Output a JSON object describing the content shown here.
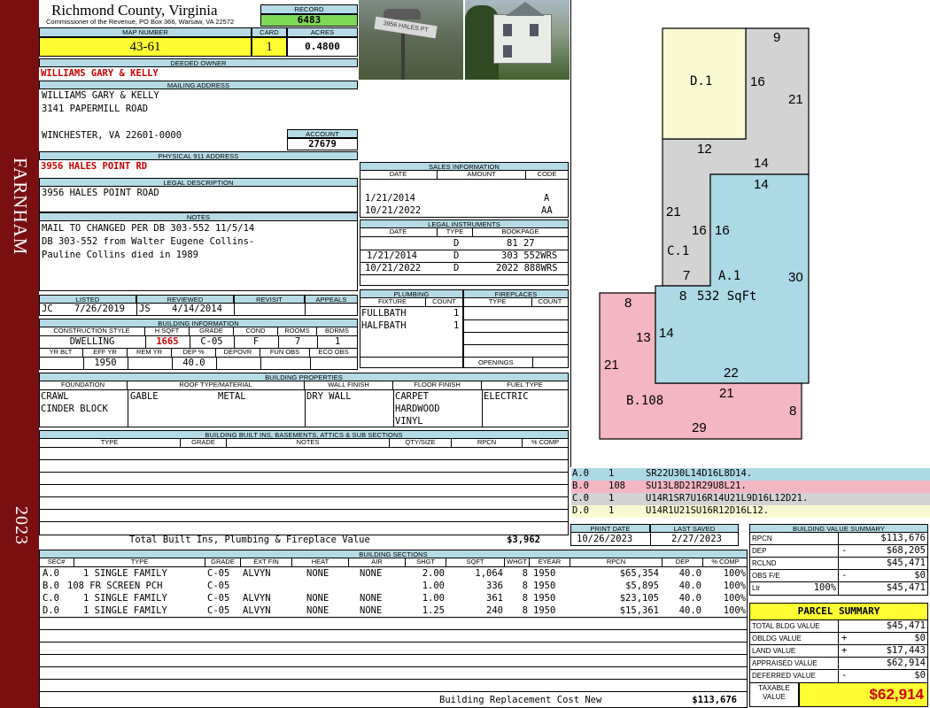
{
  "sidebar": {
    "district": "FARNHAM",
    "year": "2023"
  },
  "header": {
    "county": "Richmond County, Virginia",
    "commissioner": "Commissioner of the Revenue, PO Box 366, Warsaw, VA 22572",
    "record_label": "RECORD",
    "record": "6483",
    "map_label": "MAP NUMBER",
    "map": "43-61",
    "card_label": "CARD",
    "card": "1",
    "acres_label": "ACRES",
    "acres": "0.4800"
  },
  "owner": {
    "deeded_label": "DEEDED OWNER",
    "deeded": "WILLIAMS GARY & KELLY",
    "mailing_label": "MAILING ADDRESS",
    "mail1": "WILLIAMS GARY & KELLY",
    "mail2": "3141 PAPERMILL ROAD",
    "mail3": "WINCHESTER, VA 22601-0000",
    "account_label": "ACCOUNT",
    "account": "27679",
    "physical_label": "PHYSICAL 911 ADDRESS",
    "physical": "3956 HALES POINT RD",
    "legal_label": "LEGAL DESCRIPTION",
    "legal": "3956 HALES POINT ROAD",
    "notes_label": "NOTES",
    "note1": "MAIL TO CHANGED PER DB 303-552 11/5/14",
    "note2": "DB 303-552 from Walter Eugene Collins-",
    "note3": "Pauline Collins died in 1989"
  },
  "photos": {
    "sign_text": "3956 HALES PT"
  },
  "sales": {
    "title": "SALES INFORMATION",
    "cols": [
      "DATE",
      "AMOUNT",
      "CODE"
    ],
    "rows": [
      [
        "1/21/2014",
        "",
        "A"
      ],
      [
        "10/21/2022",
        "",
        "AA"
      ]
    ]
  },
  "legal_instruments": {
    "title": "LEGAL INSTRUMENTS",
    "cols": [
      "DATE",
      "TYPE",
      "BOOKPAGE"
    ],
    "rows": [
      [
        "",
        "D",
        "81 27"
      ],
      [
        "1/21/2014",
        "D",
        "303 552WRS"
      ],
      [
        "10/21/2022",
        "D",
        "2022 888WRS"
      ]
    ]
  },
  "plumbing": {
    "title": "PLUMBING",
    "cols": [
      "FIXTURE",
      "COUNT"
    ],
    "rows": [
      [
        "FULLBATH",
        "1"
      ],
      [
        "HALFBATH",
        "1"
      ]
    ]
  },
  "fireplaces": {
    "title": "FIREPLACES",
    "cols": [
      "TYPE",
      "COUNT"
    ],
    "openings_label": "OPENINGS"
  },
  "review": {
    "listed_label": "LISTED",
    "listed_by": "JC",
    "listed_date": "7/26/2019",
    "reviewed_label": "REVIEWED",
    "reviewed_by": "JS",
    "reviewed_date": "4/14/2014",
    "revisit_label": "REVISIT",
    "appeals_label": "APPEALS"
  },
  "building_info": {
    "title": "BUILDING INFORMATION",
    "cols1": [
      "CONSTRUCTION STYLE",
      "H SQFT",
      "GRADE",
      "COND",
      "ROOMS",
      "BDRMS"
    ],
    "vals1": [
      "DWELLING",
      "1665",
      "C-05",
      "F",
      "7",
      "1"
    ],
    "cols2": [
      "YR BLT",
      "EFF YR",
      "REM YR",
      "DEP %",
      "DEPOVR",
      "FUN OBS",
      "ECO OBS"
    ],
    "vals2": [
      "",
      "1950",
      "",
      "40.0",
      "",
      "",
      ""
    ]
  },
  "building_props": {
    "title": "BUILDING PROPERTIES",
    "cols": [
      "FOUNDATION",
      "ROOF TYPE/MATERIAL",
      "WALL FINISH",
      "FLOOR FINISH",
      "FUEL TYPE"
    ],
    "foundation": [
      "CRAWL",
      "CINDER BLOCK"
    ],
    "roof_type": "GABLE",
    "roof_material": "METAL",
    "wall": "DRY WALL",
    "floor": [
      "CARPET",
      "HARDWOOD",
      "VINYL"
    ],
    "fuel": "ELECTRIC"
  },
  "builtins": {
    "title": "BUILDING BUILT INS, BASEMENTS, ATTICS & SUB SECTIONS",
    "cols": [
      "TYPE",
      "GRADE",
      "NOTES",
      "QTY/SIZE",
      "RPCN",
      "% COMP"
    ],
    "total_label": "Total Built Ins, Plumbing & Fireplace Value",
    "total": "$3,962"
  },
  "sketch": {
    "labels": {
      "d1": "D.1",
      "c1": "C.1",
      "a1": "A.1",
      "a1_area": "532 SqFt",
      "b108": "B.108"
    },
    "dims": [
      "9",
      "16",
      "21",
      "12",
      "14",
      "14",
      "21",
      "16",
      "16",
      "7",
      "30",
      "8",
      "8",
      "13",
      "14",
      "22",
      "21",
      "21",
      "8",
      "29"
    ],
    "colors": {
      "a": "#add8e6",
      "b": "#f4b6c2",
      "c": "#d3d3d3",
      "d": "#fafad2"
    }
  },
  "vectors": [
    {
      "code": "A.0",
      "qty": "1",
      "text": "SR22U30L14D16L8D14.",
      "color": "#add8e6"
    },
    {
      "code": "B.0",
      "qty": "108",
      "text": "SU13L8D21R29U8L21.",
      "color": "#f4b6c2"
    },
    {
      "code": "C.0",
      "qty": "1",
      "text": "U14R1SR7U16R14U21L9D16L12D21.",
      "color": "#d3d3d3"
    },
    {
      "code": "D.0",
      "qty": "1",
      "text": "U14R1U21SU16R12D16L12.",
      "color": "#fafad2"
    }
  ],
  "dates": {
    "print_label": "PRINT DATE",
    "print": "10/26/2023",
    "saved_label": "LAST SAVED",
    "saved": "2/27/2023"
  },
  "sections": {
    "title": "BUILDING SECTIONS",
    "cols": [
      "SEC#",
      "TYPE",
      "GRADE",
      "EXT FIN",
      "HEAT",
      "AIR",
      "SHGT",
      "SQFT",
      "WHGT",
      "EYEAR",
      "RPCN",
      "DEP",
      "% COMP"
    ],
    "rows": [
      [
        "A.0",
        "1 SINGLE FAMILY",
        "C-05",
        "ALVYN",
        "NONE",
        "NONE",
        "2.00",
        "1,064",
        "8",
        "1950",
        "$65,354",
        "40.0",
        "100%"
      ],
      [
        "B.0",
        "108 FR SCREEN PCH",
        "C-05",
        "",
        "",
        "",
        "1.00",
        "336",
        "8",
        "1950",
        "$5,895",
        "40.0",
        "100%"
      ],
      [
        "C.0",
        "1 SINGLE FAMILY",
        "C-05",
        "ALVYN",
        "NONE",
        "NONE",
        "1.00",
        "361",
        "8",
        "1950",
        "$23,105",
        "40.0",
        "100%"
      ],
      [
        "D.0",
        "1 SINGLE FAMILY",
        "C-05",
        "ALVYN",
        "NONE",
        "NONE",
        "1.25",
        "240",
        "8",
        "1950",
        "$15,361",
        "40.0",
        "100%"
      ]
    ],
    "replacement_label": "Building Replacement Cost New",
    "replacement": "$113,676"
  },
  "value_summary": {
    "title": "BUILDING VALUE SUMMARY",
    "rows": [
      {
        "label": "RPCN",
        "sign": "",
        "pct": "",
        "value": "$113,676"
      },
      {
        "label": "DEP",
        "sign": "-",
        "pct": "",
        "value": "$68,205"
      },
      {
        "label": "RCLND",
        "sign": "",
        "pct": "",
        "value": "$45,471"
      },
      {
        "label": "OBS F/E",
        "sign": "-",
        "pct": "",
        "value": "$0"
      },
      {
        "label": "Ltr",
        "sign": "",
        "pct": "100%",
        "value": "$45,471"
      }
    ]
  },
  "parcel": {
    "title": "PARCEL SUMMARY",
    "rows": [
      {
        "label": "TOTAL BLDG VALUE",
        "sign": "",
        "value": "$45,471"
      },
      {
        "label": "OBLDG VALUE",
        "sign": "+",
        "value": "$0"
      },
      {
        "label": "LAND VALUE",
        "sign": "+",
        "value": "$17,443"
      },
      {
        "label": "APPRAISED VALUE",
        "sign": "",
        "value": "$62,914"
      },
      {
        "label": "DEFERRED VALUE",
        "sign": "-",
        "value": "$0"
      }
    ],
    "taxable_label1": "TAXABLE",
    "taxable_label2": "VALUE",
    "taxable": "$62,914"
  }
}
